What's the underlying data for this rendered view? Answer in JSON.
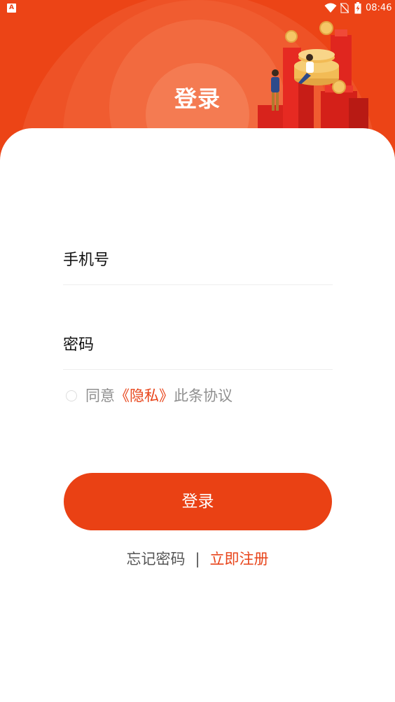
{
  "status_bar": {
    "app_icon": "A",
    "time": "08:46",
    "icons": [
      "wifi-icon",
      "sim-off-icon",
      "battery-charging-icon"
    ]
  },
  "header": {
    "title": "登录",
    "illustration": "finance-illustration"
  },
  "form": {
    "phone_placeholder": "手机号",
    "password_placeholder": "密码"
  },
  "agreement": {
    "prefix": "同意",
    "link": "《隐私》",
    "suffix": "此条协议"
  },
  "login_button": "登录",
  "links": {
    "forgot": "忘记密码",
    "separator": "|",
    "register": "立即注册"
  },
  "colors": {
    "brand": "#ec4416",
    "accent_text": "#e8441a",
    "muted_text": "#8f8f8f"
  }
}
